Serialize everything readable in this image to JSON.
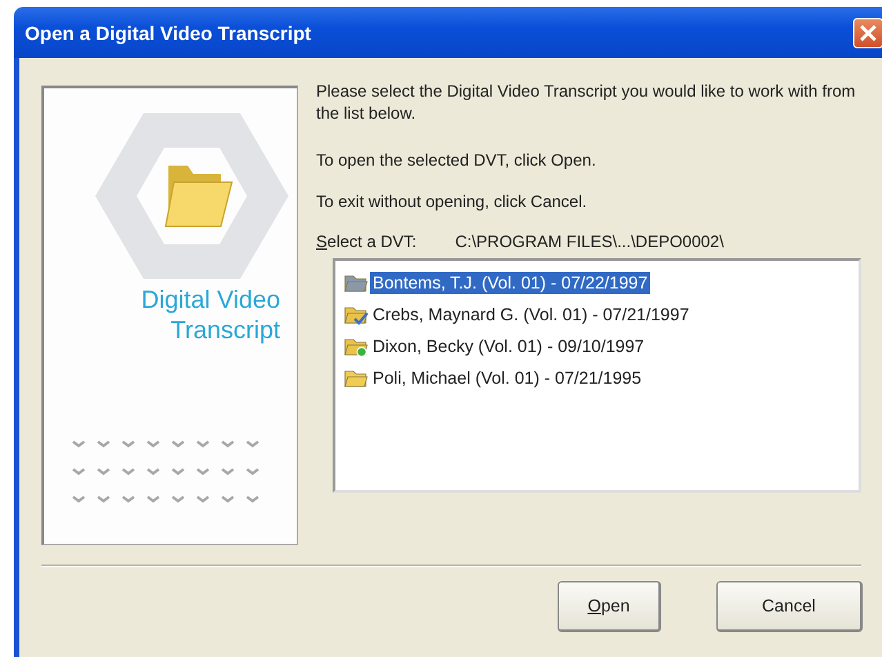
{
  "window": {
    "title": "Open a Digital Video Transcript"
  },
  "brand": {
    "line_1": "Digital Video",
    "line_2": "Transcript"
  },
  "instructions": [
    "Please select the Digital Video Transcript you would like to work with from the list below.",
    "To open the selected DVT, click Open.",
    "To exit without opening, click Cancel."
  ],
  "select_label": "Select a DVT:",
  "path": "C:\\PROGRAM FILES\\...\\DEPO0002\\",
  "files": [
    {
      "label": "Bontems, T.J. (Vol. 01) - 07/22/1997",
      "kind": "grey",
      "selected": true
    },
    {
      "label": "Crebs, Maynard G. (Vol. 01) - 07/21/1997",
      "kind": "checked",
      "selected": false
    },
    {
      "label": "Dixon, Becky (Vol. 01) - 09/10/1997",
      "kind": "new",
      "selected": false
    },
    {
      "label": "Poli, Michael (Vol. 01) - 07/21/1995",
      "kind": "plain",
      "selected": false
    }
  ],
  "buttons": [
    "Open",
    "Cancel"
  ]
}
